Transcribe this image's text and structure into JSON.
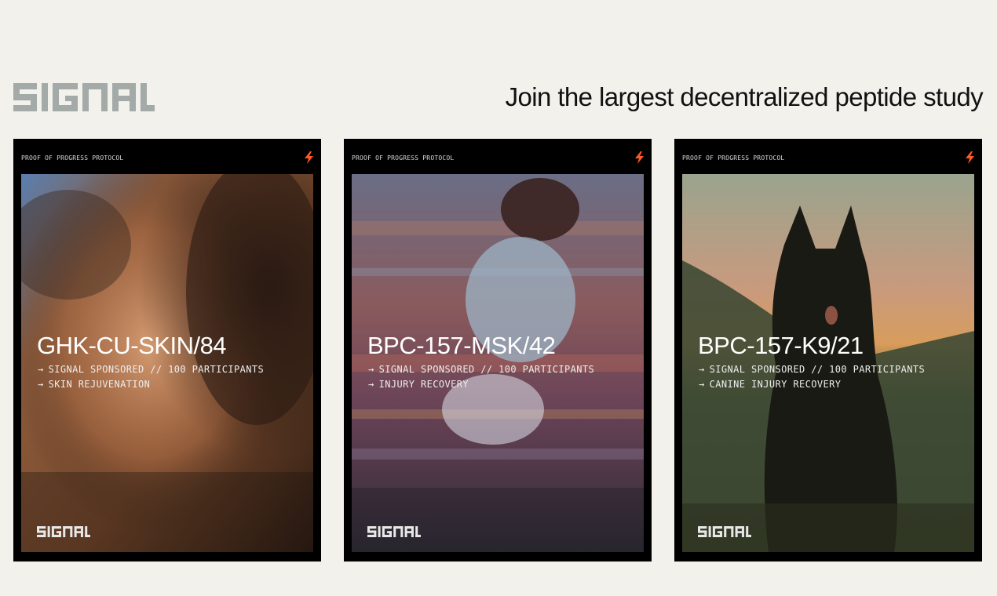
{
  "brand": {
    "name": "SIGNAL"
  },
  "headline": "Join the largest decentralized peptide study",
  "colors": {
    "background": "#f2f1ec",
    "logo_gray": "#a3aaa8",
    "accent": "#ff5a1f",
    "card": "#000000"
  },
  "cards": [
    {
      "protocol": "PROOF OF PROGRESS PROTOCOL",
      "study_id": "GHK-CU-SKIN/84",
      "sponsor_line": "SIGNAL SPONSORED // 100 PARTICIPANTS",
      "focus": "SKIN REJUVENATION",
      "arrow": "→",
      "bolt_icon": "lightning-bolt-icon",
      "footer_logo": "SIGNAL"
    },
    {
      "protocol": "PROOF OF PROGRESS PROTOCOL",
      "study_id": "BPC-157-MSK/42",
      "sponsor_line": "SIGNAL SPONSORED // 100 PARTICIPANTS",
      "focus": "INJURY RECOVERY",
      "arrow": "→",
      "bolt_icon": "lightning-bolt-icon",
      "footer_logo": "SIGNAL"
    },
    {
      "protocol": "PROOF OF PROGRESS PROTOCOL",
      "study_id": "BPC-157-K9/21",
      "sponsor_line": "SIGNAL SPONSORED // 100 PARTICIPANTS",
      "focus": "CANINE INJURY RECOVERY",
      "arrow": "→",
      "bolt_icon": "lightning-bolt-icon",
      "footer_logo": "SIGNAL"
    }
  ]
}
